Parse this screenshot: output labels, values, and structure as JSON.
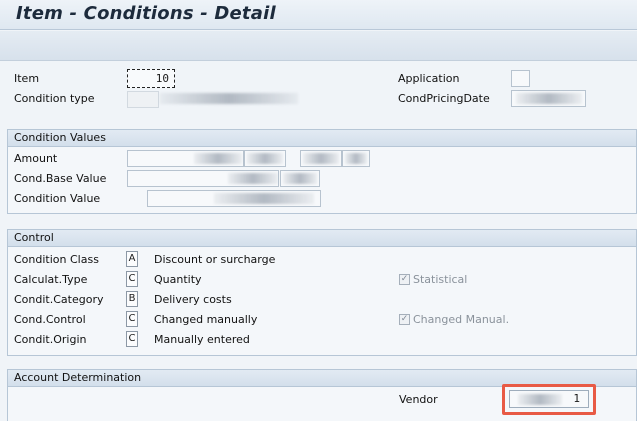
{
  "window": {
    "title": "Item - Conditions - Detail"
  },
  "header": {
    "item_label": "Item",
    "item_value": "10",
    "condition_type_label": "Condition type",
    "application_label": "Application",
    "cond_pricing_date_label": "CondPricingDate"
  },
  "condition_values": {
    "title": "Condition Values",
    "amount_label": "Amount",
    "cond_base_value_label": "Cond.Base Value",
    "condition_value_label": "Condition Value"
  },
  "control": {
    "title": "Control",
    "rows": [
      {
        "label": "Condition Class",
        "code": "A",
        "text": "Discount or surcharge"
      },
      {
        "label": "Calculat.Type",
        "code": "C",
        "text": "Quantity"
      },
      {
        "label": "Condit.Category",
        "code": "B",
        "text": "Delivery costs"
      },
      {
        "label": "Cond.Control",
        "code": "C",
        "text": "Changed manually"
      },
      {
        "label": "Condit.Origin",
        "code": "C",
        "text": "Manually entered"
      }
    ],
    "statistical_label": "Statistical",
    "statistical_checked": true,
    "changed_manual_label": "Changed Manual.",
    "changed_manual_checked": true
  },
  "account_determination": {
    "title": "Account Determination",
    "vendor_label": "Vendor",
    "vendor_value": "1"
  },
  "colors": {
    "highlight": "#e85a45",
    "group_header": "#d3dfeb"
  }
}
